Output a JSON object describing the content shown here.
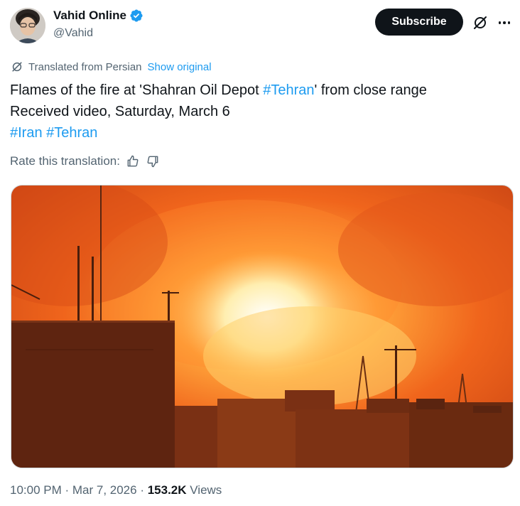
{
  "author": {
    "display_name": "Vahid Online",
    "handle": "@Vahid",
    "verified": true
  },
  "header": {
    "subscribe_label": "Subscribe"
  },
  "translation": {
    "notice": "Translated from Persian",
    "show_original": "Show original",
    "rate_label": "Rate this translation:"
  },
  "tweet": {
    "line1_pre": "Flames of the fire at 'Shahran Oil Depot ",
    "line1_hashtag": "#Tehran",
    "line1_post": "' from close range",
    "line2": "Received video, Saturday, March 6",
    "hashtags": [
      "#Iran",
      "#Tehran"
    ]
  },
  "meta": {
    "time": "10:00 PM",
    "sep1": " · ",
    "date": "Mar 7, 2026",
    "sep2": " · ",
    "views_count": "153.2K",
    "views_label": " Views"
  },
  "colors": {
    "accent": "#1d9bf0",
    "text_primary": "#0f1419",
    "text_secondary": "#536471",
    "button_bg": "#0f1419"
  },
  "icons": {
    "verified": "verified-badge-icon",
    "grok": "grok-icon",
    "more": "more-icon",
    "translate": "translate-icon",
    "thumbs_up": "thumbs-up-icon",
    "thumbs_down": "thumbs-down-icon"
  }
}
